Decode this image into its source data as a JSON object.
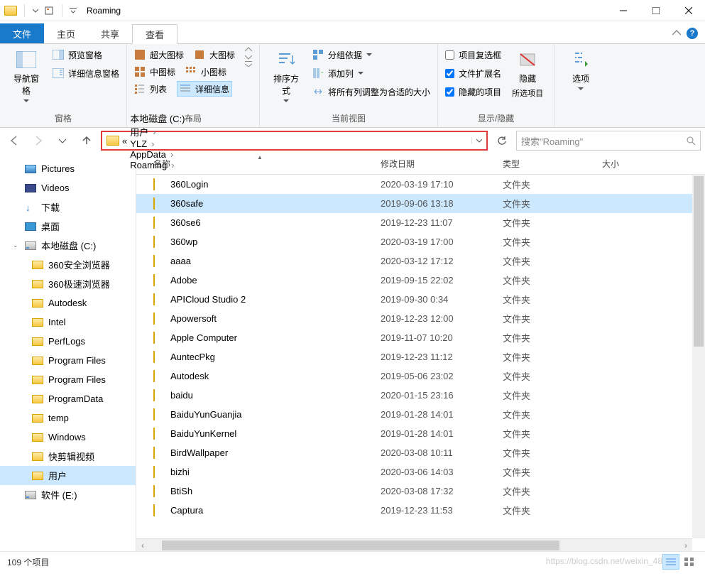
{
  "window": {
    "title": "Roaming"
  },
  "tabs": {
    "file": "文件",
    "home": "主页",
    "share": "共享",
    "view": "查看"
  },
  "ribbon": {
    "panes": {
      "nav_pane": "导航窗格",
      "preview_pane": "预览窗格",
      "details_pane": "详细信息窗格",
      "group_label": "窗格"
    },
    "layout": {
      "extra_large": "超大图标",
      "large": "大图标",
      "medium": "中图标",
      "small": "小图标",
      "list": "列表",
      "details": "详细信息",
      "group_label": "布局"
    },
    "current_view": {
      "sort": "排序方式",
      "group_by": "分组依据",
      "add_columns": "添加列",
      "fit_columns": "将所有列调整为合适的大小",
      "group_label": "当前视图"
    },
    "show_hide": {
      "item_checkboxes": "项目复选框",
      "file_ext": "文件扩展名",
      "hidden_items": "隐藏的项目",
      "hide": "隐藏",
      "hide_sub": "所选项目",
      "group_label": "显示/隐藏"
    },
    "options": "选项"
  },
  "address": {
    "crumb_prefix": "«",
    "crumbs": [
      "本地磁盘 (C:)",
      "用户",
      "YLZ",
      "AppData",
      "Roaming"
    ],
    "refresh_tooltip": "刷新"
  },
  "search": {
    "placeholder": "搜索\"Roaming\""
  },
  "nav": {
    "items": [
      {
        "label": "Pictures",
        "icon": "pic",
        "indent": 0
      },
      {
        "label": "Videos",
        "icon": "vid",
        "indent": 0
      },
      {
        "label": "下载",
        "icon": "dl",
        "indent": 0
      },
      {
        "label": "桌面",
        "icon": "desk",
        "indent": 0
      },
      {
        "label": "本地磁盘 (C:)",
        "icon": "disk",
        "indent": 0,
        "expanded": true
      },
      {
        "label": "360安全浏览器",
        "icon": "folder",
        "indent": 1
      },
      {
        "label": "360极速浏览器",
        "icon": "folder",
        "indent": 1
      },
      {
        "label": "Autodesk",
        "icon": "folder",
        "indent": 1
      },
      {
        "label": "Intel",
        "icon": "folder",
        "indent": 1
      },
      {
        "label": "PerfLogs",
        "icon": "folder",
        "indent": 1
      },
      {
        "label": "Program Files",
        "icon": "folder",
        "indent": 1
      },
      {
        "label": "Program Files",
        "icon": "folder",
        "indent": 1
      },
      {
        "label": "ProgramData",
        "icon": "folder",
        "indent": 1
      },
      {
        "label": "temp",
        "icon": "folder",
        "indent": 1
      },
      {
        "label": "Windows",
        "icon": "folder",
        "indent": 1
      },
      {
        "label": "快剪辑视频",
        "icon": "folder",
        "indent": 1
      },
      {
        "label": "用户",
        "icon": "folder",
        "indent": 1,
        "selected": true
      },
      {
        "label": "软件 (E:)",
        "icon": "disk",
        "indent": 0
      }
    ]
  },
  "columns": {
    "name": "名称",
    "date": "修改日期",
    "type": "类型",
    "size": "大小"
  },
  "files": [
    {
      "name": "360Login",
      "date": "2020-03-19 17:10",
      "type": "文件夹"
    },
    {
      "name": "360safe",
      "date": "2019-09-06 13:18",
      "type": "文件夹",
      "selected": true
    },
    {
      "name": "360se6",
      "date": "2019-12-23 11:07",
      "type": "文件夹"
    },
    {
      "name": "360wp",
      "date": "2020-03-19 17:00",
      "type": "文件夹"
    },
    {
      "name": "aaaa",
      "date": "2020-03-12 17:12",
      "type": "文件夹"
    },
    {
      "name": "Adobe",
      "date": "2019-09-15 22:02",
      "type": "文件夹"
    },
    {
      "name": "APICloud Studio 2",
      "date": "2019-09-30 0:34",
      "type": "文件夹"
    },
    {
      "name": "Apowersoft",
      "date": "2019-12-23 12:00",
      "type": "文件夹"
    },
    {
      "name": "Apple Computer",
      "date": "2019-11-07 10:20",
      "type": "文件夹"
    },
    {
      "name": "AuntecPkg",
      "date": "2019-12-23 11:12",
      "type": "文件夹"
    },
    {
      "name": "Autodesk",
      "date": "2019-05-06 23:02",
      "type": "文件夹"
    },
    {
      "name": "baidu",
      "date": "2020-01-15 23:16",
      "type": "文件夹"
    },
    {
      "name": "BaiduYunGuanjia",
      "date": "2019-01-28 14:01",
      "type": "文件夹"
    },
    {
      "name": "BaiduYunKernel",
      "date": "2019-01-28 14:01",
      "type": "文件夹"
    },
    {
      "name": "BirdWallpaper",
      "date": "2020-03-08 10:11",
      "type": "文件夹"
    },
    {
      "name": "bizhi",
      "date": "2020-03-06 14:03",
      "type": "文件夹"
    },
    {
      "name": "BtiSh",
      "date": "2020-03-08 17:32",
      "type": "文件夹"
    },
    {
      "name": "Captura",
      "date": "2019-12-23 11:53",
      "type": "文件夹"
    }
  ],
  "status": {
    "item_count": "109 个项目"
  },
  "watermark": "https://blog.csdn.net/weixin_48"
}
